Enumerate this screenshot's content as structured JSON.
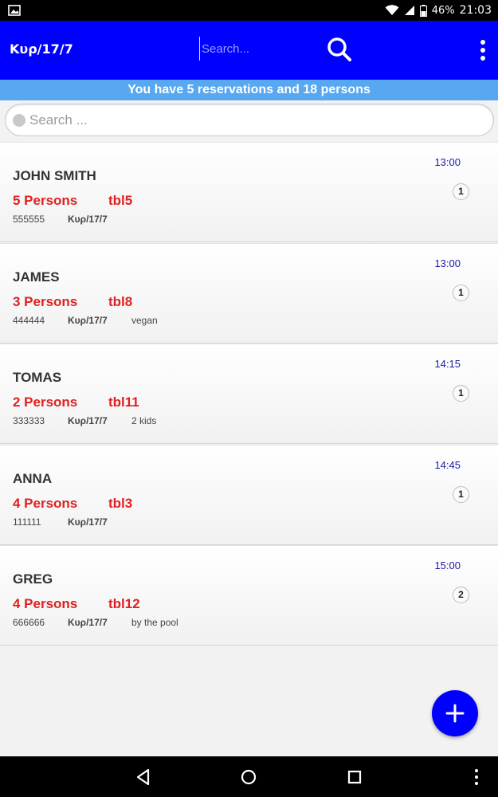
{
  "status_bar": {
    "battery": "46%",
    "time": "21:03"
  },
  "app_bar": {
    "title": "Κυρ/17/7",
    "search_placeholder": "Search..."
  },
  "summary": "You have 5 reservations and 18 persons",
  "filter": {
    "placeholder": "Search ..."
  },
  "reservations": [
    {
      "name": "JOHN SMITH",
      "persons": "5 Persons",
      "table": "tbl5",
      "phone": "555555",
      "date": "Κυρ/17/7",
      "note": "",
      "time": "13:00",
      "count": "1"
    },
    {
      "name": "JAMES",
      "persons": "3 Persons",
      "table": "tbl8",
      "phone": "444444",
      "date": "Κυρ/17/7",
      "note": "vegan",
      "time": "13:00",
      "count": "1"
    },
    {
      "name": "TOMAS",
      "persons": "2 Persons",
      "table": "tbl11",
      "phone": "333333",
      "date": "Κυρ/17/7",
      "note": "2 kids",
      "time": "14:15",
      "count": "1"
    },
    {
      "name": "ANNA",
      "persons": "4 Persons",
      "table": "tbl3",
      "phone": "111111",
      "date": "Κυρ/17/7",
      "note": "",
      "time": "14:45",
      "count": "1"
    },
    {
      "name": "GREG",
      "persons": "4 Persons",
      "table": "tbl12",
      "phone": "666666",
      "date": "Κυρ/17/7",
      "note": "by the pool",
      "time": "15:00",
      "count": "2"
    }
  ],
  "icons": {
    "status_left": "image-icon",
    "wifi": "wifi-icon",
    "signal": "signal-icon",
    "battery": "battery-icon",
    "search": "search-icon",
    "menu": "more-vert-icon",
    "filter_search": "search-icon",
    "fab": "add-icon",
    "nav_back": "back-icon",
    "nav_home": "home-icon",
    "nav_recents": "recents-icon",
    "nav_menu": "more-vert-icon"
  },
  "colors": {
    "app_bar": "#0000fe",
    "summary_banner": "#57a7f1",
    "accent_red": "#e02020",
    "time_blue": "#1a1aa8",
    "fab": "#0000fe"
  }
}
